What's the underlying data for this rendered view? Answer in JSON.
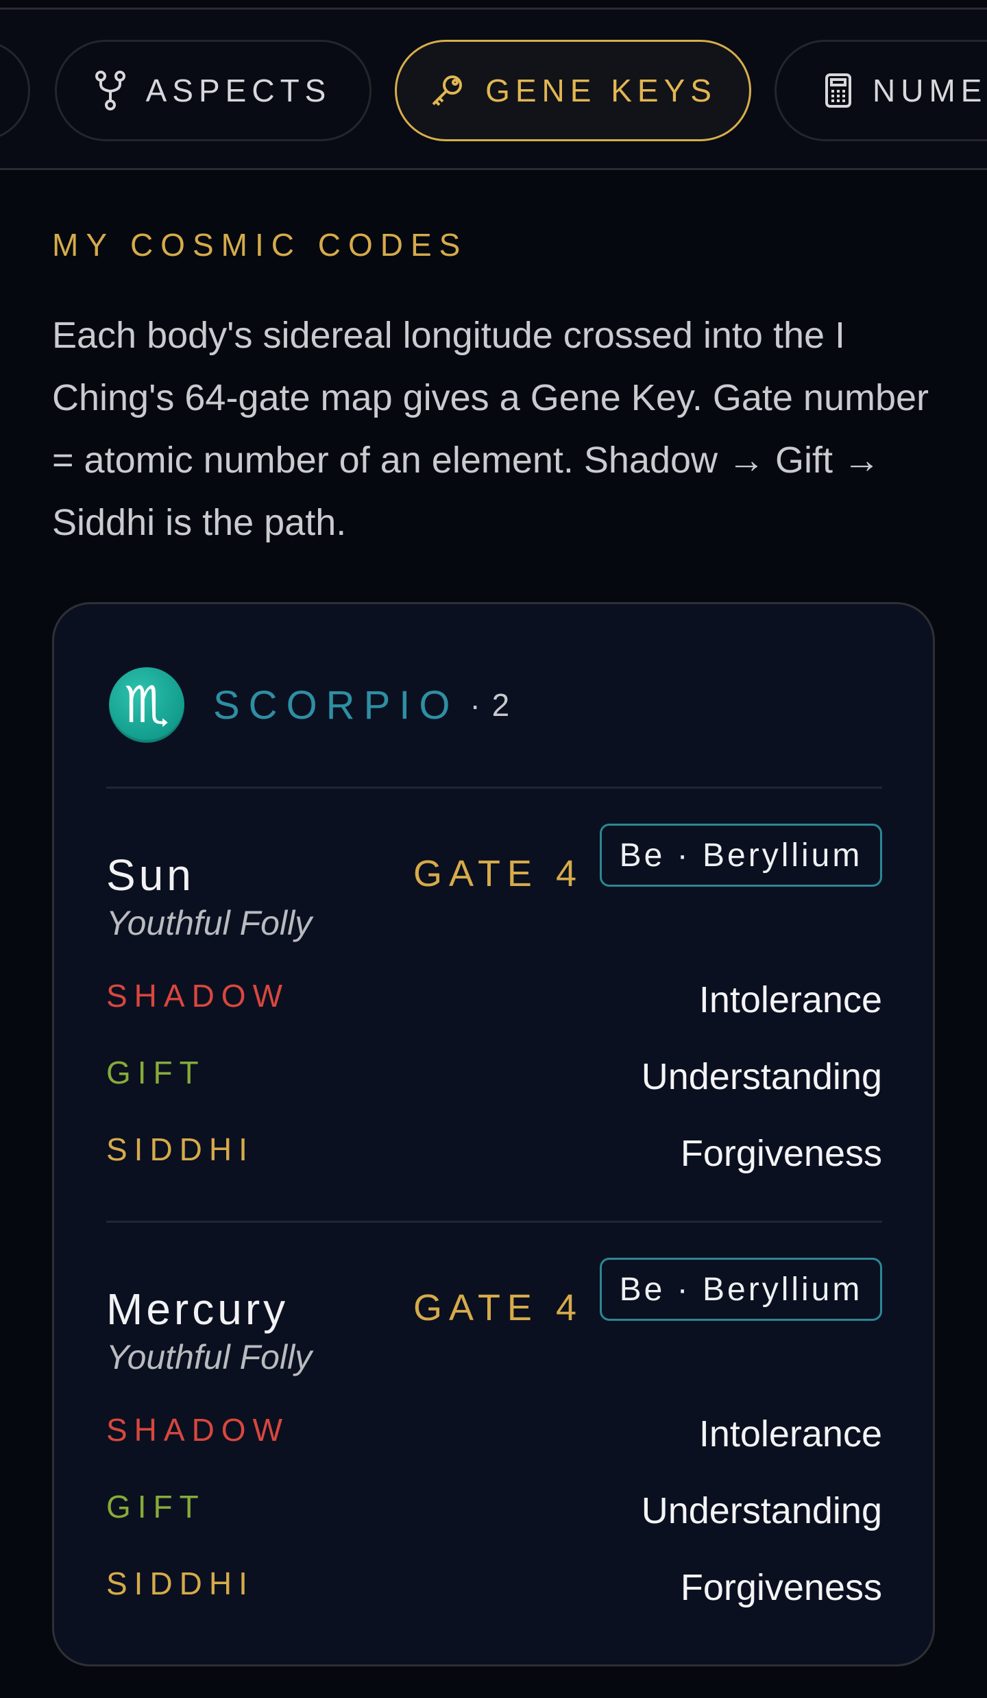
{
  "tabs": {
    "aspects": "ASPECTS",
    "gene_keys": "GENE KEYS",
    "numerology": "NUME"
  },
  "section": {
    "label": "MY COSMIC CODES",
    "intro": "Each body's sidereal longitude crossed into the I Ching's 64-gate map gives a Gene Key. Gate number = atomic number of an element. Shadow → Gift → Siddhi is the path."
  },
  "card": {
    "sign": {
      "glyph": "♏",
      "name": "SCORPIO",
      "count": "· 2",
      "color": "#1aa899"
    },
    "planets": [
      {
        "name": "Sun",
        "gate": "GATE 4",
        "element": "Be · Beryllium",
        "gate_name": "Youthful Folly",
        "shadow_label": "SHADOW",
        "shadow": "Intolerance",
        "gift_label": "GIFT",
        "gift": "Understanding",
        "siddhi_label": "SIDDHI",
        "siddhi": "Forgiveness"
      },
      {
        "name": "Mercury",
        "gate": "GATE 4",
        "element": "Be · Beryllium",
        "gate_name": "Youthful Folly",
        "shadow_label": "SHADOW",
        "shadow": "Intolerance",
        "gift_label": "GIFT",
        "gift": "Understanding",
        "siddhi_label": "SIDDHI",
        "siddhi": "Forgiveness"
      }
    ]
  },
  "colors": {
    "accent_gold": "#d6ab4a",
    "shadow": "#d9473e",
    "gift": "#86ab3a",
    "teal": "#2e8fa3"
  }
}
